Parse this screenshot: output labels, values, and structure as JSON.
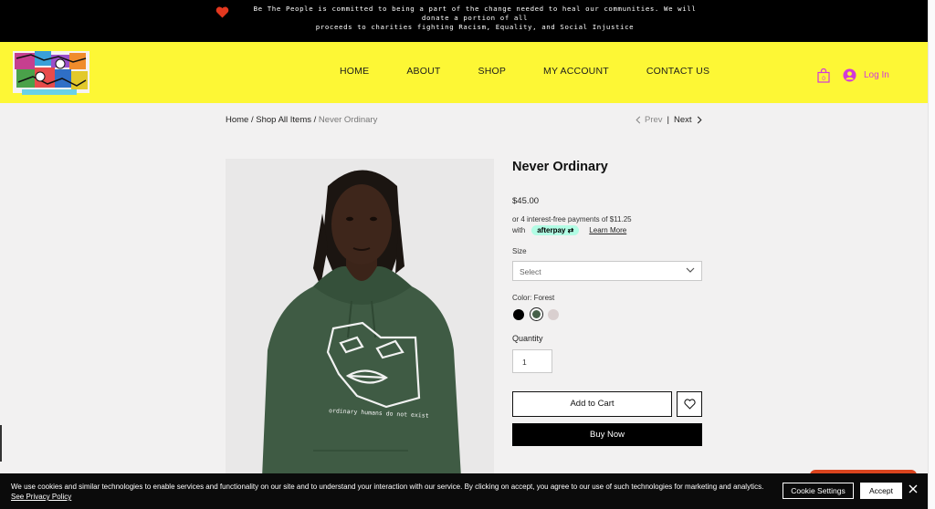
{
  "announcement": {
    "line1": "Be The People is committed to being a part of the change needed to heal our communities. We will donate a portion of all",
    "line2": "proceeds to charities fighting  Racism, Equality, and Social Injustice"
  },
  "nav": {
    "items": [
      "HOME",
      "ABOUT",
      "SHOP",
      "MY ACCOUNT",
      "CONTACT US"
    ],
    "cart_count": "0",
    "login_label": "Log In"
  },
  "breadcrumb": {
    "home": "Home",
    "sep1": " / ",
    "shop": "Shop All Items",
    "sep2": " / ",
    "current": "Never Ordinary"
  },
  "pager": {
    "prev": "Prev",
    "sep": "|",
    "next": "Next"
  },
  "product": {
    "title": "Never Ordinary",
    "price": "$45.00",
    "installments": "or 4 interest-free payments of $11.25",
    "with": "with",
    "afterpay": "afterpay",
    "learn_more": "Learn More",
    "print_text": "ordinary humans do not exist"
  },
  "options": {
    "size_label": "Size",
    "size_value": "Select",
    "color_label": "Color: Forest",
    "swatches": [
      "#000000",
      "#46604a",
      "#d9cfcf"
    ],
    "quantity_label": "Quantity",
    "quantity_value": "1"
  },
  "actions": {
    "add_to_cart": "Add to Cart",
    "buy_now": "Buy Now"
  },
  "cookie": {
    "text": "We use cookies and similar technologies to enable services and functionality on our site and to understand your interaction with our service. By clicking on accept, you agree to our use of such technologies for marketing and analytics.",
    "privacy_link": "See Privacy Policy",
    "settings_label": "Cookie Settings",
    "accept_label": "Accept"
  },
  "colors": {
    "header_bg": "#fdf735",
    "login_accent": "#d23ad8",
    "afterpay_mint": "#b2fce4",
    "hoodie": "#3f5b44"
  }
}
